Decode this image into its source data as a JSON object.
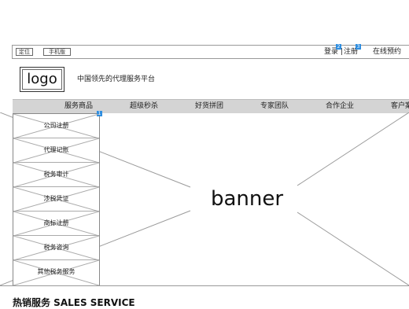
{
  "topbar": {
    "location_label": "定位",
    "mobile_label": "手机版",
    "login_label": "登录",
    "register_label": "注册",
    "book_label": "在线预约",
    "login_badge": "2",
    "register_badge": "3"
  },
  "header": {
    "logo_text": "logo",
    "slogan": "中国领先的代理服务平台"
  },
  "nav": {
    "items": [
      {
        "label": "服务商品"
      },
      {
        "label": "超级秒杀"
      },
      {
        "label": "好货拼团"
      },
      {
        "label": "专家团队"
      },
      {
        "label": "合作企业"
      },
      {
        "label": "客户案"
      }
    ]
  },
  "menu": {
    "badge": "1",
    "items": [
      {
        "label": "公司注册"
      },
      {
        "label": "代理记账"
      },
      {
        "label": "税务审计"
      },
      {
        "label": "涉税凭证"
      },
      {
        "label": "商标注册"
      },
      {
        "label": "税务咨询"
      },
      {
        "label": "其他税务服务"
      }
    ]
  },
  "banner": {
    "text": "banner"
  },
  "section": {
    "title": "热销服务 SALES SERVICE"
  }
}
